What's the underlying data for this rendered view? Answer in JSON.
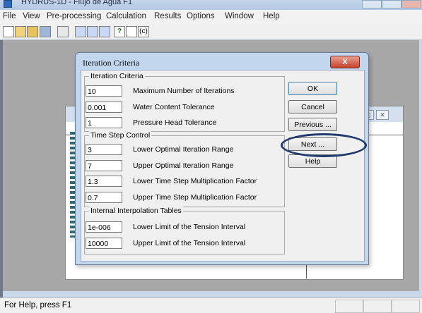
{
  "window": {
    "title": "HYDRUS-1D - Flujo de Agua F1"
  },
  "menu": [
    "File",
    "View",
    "Pre-processing",
    "Calculation",
    "Results",
    "Options",
    "Window",
    "Help"
  ],
  "toolbar": {
    "copyright_label": "(c)",
    "help_label": "?"
  },
  "status_bar": {
    "text": "For Help, press F1"
  },
  "dialog": {
    "title": "Iteration Criteria",
    "close_label": "X",
    "groups": {
      "iteration": {
        "label": "Iteration Criteria",
        "fields": [
          {
            "value": "10",
            "label": "Maximum Number of Iterations"
          },
          {
            "value": "0.001",
            "label": "Water Content Tolerance"
          },
          {
            "value": "1",
            "label": "Pressure Head Tolerance"
          }
        ]
      },
      "time_step": {
        "label": "Time Step Control",
        "fields": [
          {
            "value": "3",
            "label": "Lower Optimal Iteration Range"
          },
          {
            "value": "7",
            "label": "Upper Optimal Iteration Range"
          },
          {
            "value": "1.3",
            "label": "Lower Time Step Multiplication Factor"
          },
          {
            "value": "0.7",
            "label": "Upper Time Step Multiplication Factor"
          }
        ]
      },
      "interpolation": {
        "label": "Internal Interpolation Tables",
        "fields": [
          {
            "value": "1e-006",
            "label": "Lower Limit of the Tension Interval"
          },
          {
            "value": "10000",
            "label": "Upper Limit of the Tension Interval"
          }
        ]
      }
    },
    "buttons": {
      "ok": "OK",
      "cancel": "Cancel",
      "previous": "Previous ...",
      "next": "Next ...",
      "help": "Help"
    }
  },
  "colors": {
    "annotation_ellipse": "#1f3b6e",
    "close_button": "#c7422c"
  }
}
